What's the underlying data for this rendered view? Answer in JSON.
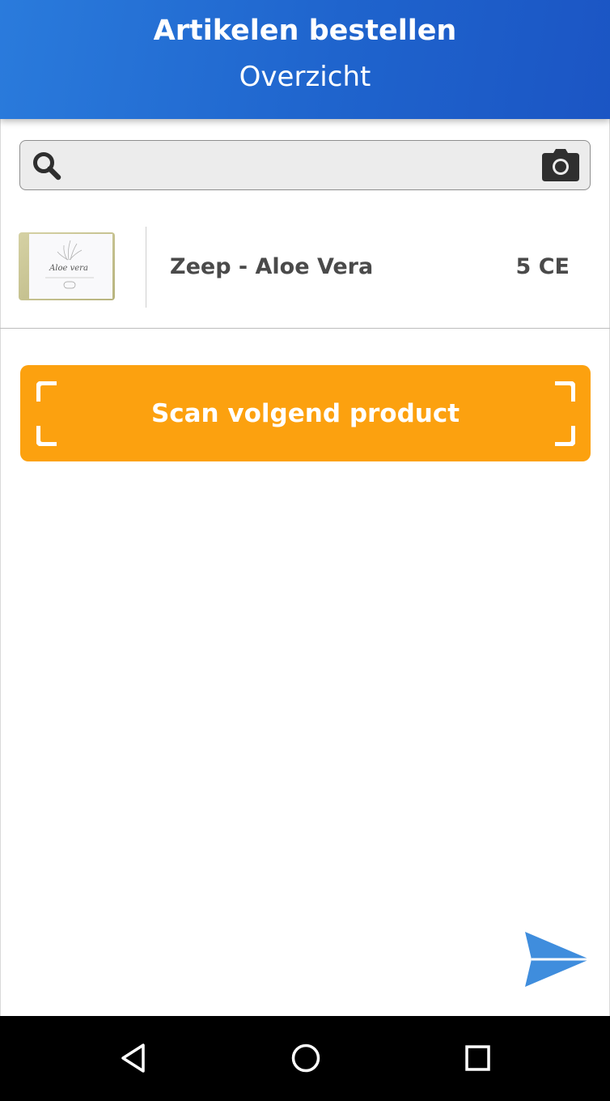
{
  "header": {
    "title": "Artikelen bestellen",
    "subtitle": "Overzicht"
  },
  "search": {
    "value": "",
    "placeholder": "",
    "search_icon": "search-icon",
    "camera_icon": "camera-icon"
  },
  "products": [
    {
      "name": "Zeep - Aloe Vera",
      "quantity": "5 CE",
      "image_label": "Aloe vera"
    }
  ],
  "scan_button": {
    "label": "Scan volgend product",
    "icon": "scan-frame-icon"
  },
  "send_button": {
    "icon": "send-icon"
  },
  "nav_bar": {
    "back_icon": "back-triangle-icon",
    "home_icon": "home-circle-icon",
    "recents_icon": "recents-square-icon"
  },
  "colors": {
    "header_blue": "#1f64cd",
    "accent_orange": "#fca10f",
    "send_blue": "#3f8ddd",
    "nav_black": "#000000"
  }
}
